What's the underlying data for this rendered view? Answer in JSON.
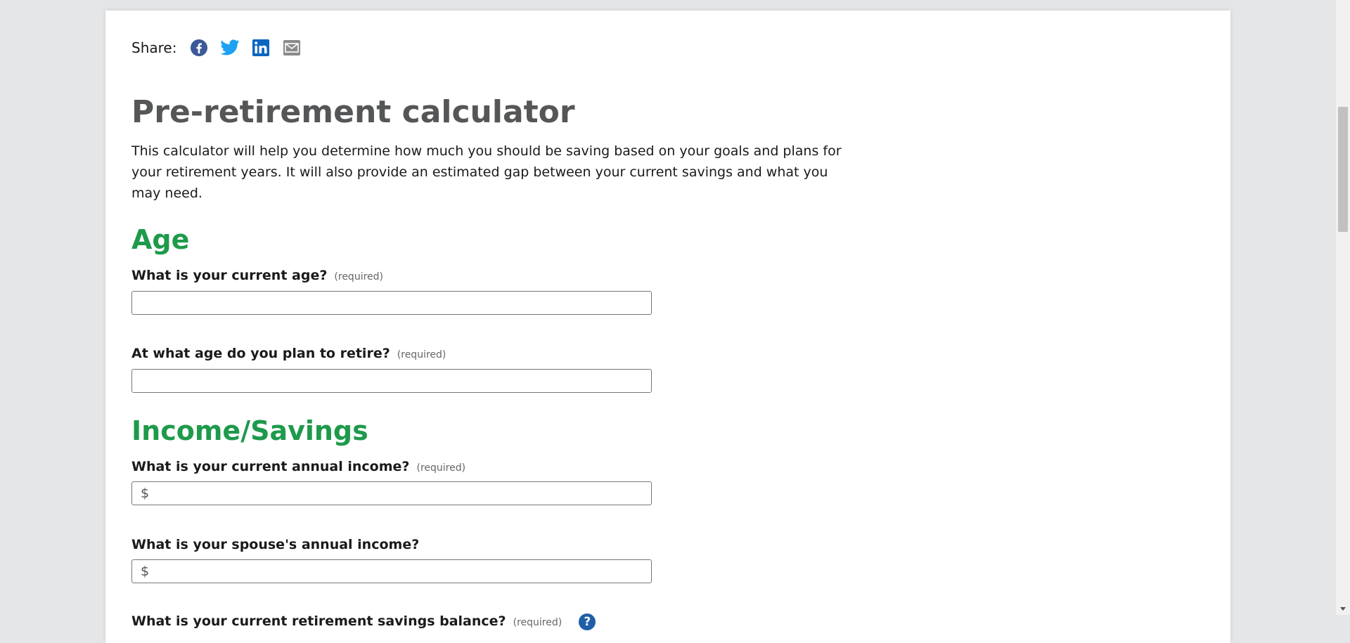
{
  "share": {
    "label": "Share:",
    "icons": [
      "facebook-icon",
      "twitter-icon",
      "linkedin-icon",
      "email-icon"
    ]
  },
  "colors": {
    "facebook": "#3b5998",
    "twitter": "#1da1f2",
    "linkedin": "#0a66c2",
    "email": "#8a8a8a",
    "heading_green": "#1e9a4b",
    "title_gray": "#555657",
    "help_blue": "#1f5fa8"
  },
  "page": {
    "title": "Pre-retirement calculator",
    "intro": "This calculator will help you determine how much you should be saving based on your goals and plans for your retirement years. It will also provide an estimated gap between your current savings and what you may need."
  },
  "sections": {
    "age": {
      "heading": "Age",
      "current_age": {
        "label": "What is your current age?",
        "required": "(required)",
        "value": ""
      },
      "retire_age": {
        "label": "At what age do you plan to retire?",
        "required": "(required)",
        "value": ""
      }
    },
    "income": {
      "heading": "Income/Savings",
      "annual_income": {
        "label": "What is your current annual income?",
        "required": "(required)",
        "prefix": "$",
        "value": ""
      },
      "spouse_income": {
        "label": "What is your spouse's annual income?",
        "prefix": "$",
        "value": ""
      },
      "savings_balance": {
        "label": "What is your current retirement savings balance?",
        "required": "(required)",
        "help": "?"
      }
    }
  }
}
